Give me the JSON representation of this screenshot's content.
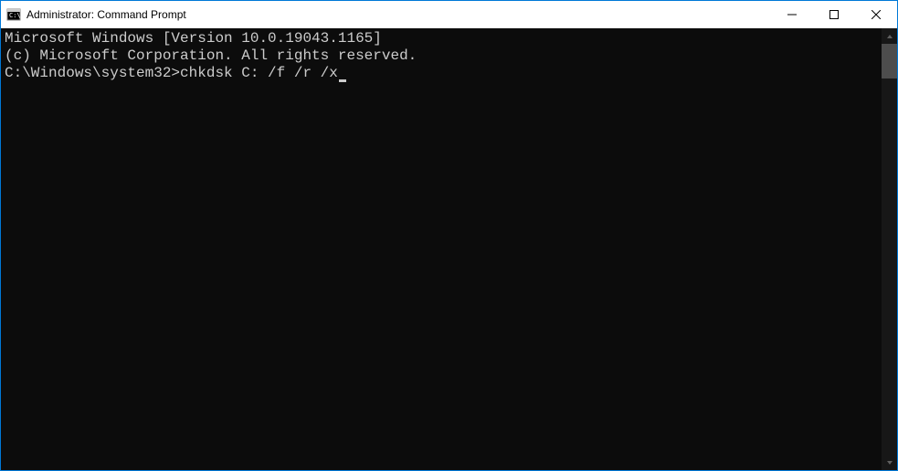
{
  "window": {
    "title": "Administrator: Command Prompt"
  },
  "terminal": {
    "line1": "Microsoft Windows [Version 10.0.19043.1165]",
    "line2": "(c) Microsoft Corporation. All rights reserved.",
    "blank": "",
    "prompt": "C:\\Windows\\system32>",
    "command": "chkdsk C: /f /r /x"
  }
}
